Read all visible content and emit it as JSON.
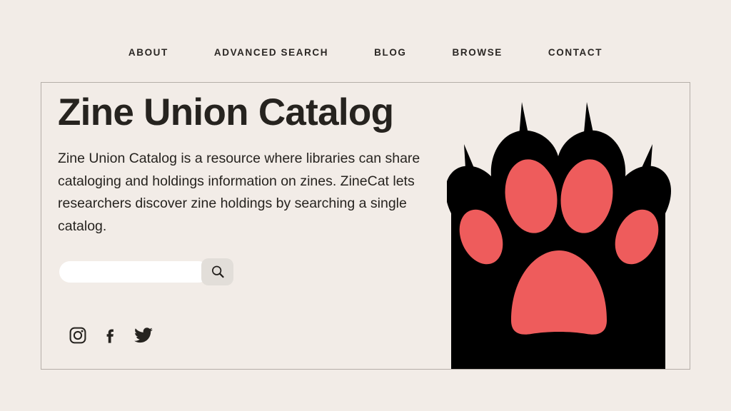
{
  "theme": {
    "background": "#f2ece7",
    "text": "#26231f",
    "nav_text": "#2b2724",
    "card_border": "#b5aea8",
    "input_background": "#ffffff",
    "button_background": "#e2ded9",
    "paw_black": "#000000",
    "paw_coral": "#ee5c5c"
  },
  "nav": {
    "items": [
      {
        "label": "ABOUT",
        "name": "nav-about"
      },
      {
        "label": "ADVANCED SEARCH",
        "name": "nav-advanced-search"
      },
      {
        "label": "BLOG",
        "name": "nav-blog"
      },
      {
        "label": "BROWSE",
        "name": "nav-browse"
      },
      {
        "label": "CONTACT",
        "name": "nav-contact"
      }
    ]
  },
  "hero": {
    "title": "Zine Union Catalog",
    "description": "Zine Union Catalog is a resource where libraries can share cataloging and holdings information on zines. ZineCat lets researchers discover zine holdings by searching a single catalog."
  },
  "search": {
    "value": "",
    "placeholder": "",
    "button_icon": "search-icon",
    "button_label": "Search"
  },
  "social": [
    {
      "name": "instagram-icon",
      "label": "Instagram"
    },
    {
      "name": "facebook-icon",
      "label": "Facebook"
    },
    {
      "name": "twitter-icon",
      "label": "Twitter"
    }
  ],
  "illustration": {
    "name": "cat-paw-illustration",
    "description": "Black cat paw with four claws and coral toe beans"
  }
}
